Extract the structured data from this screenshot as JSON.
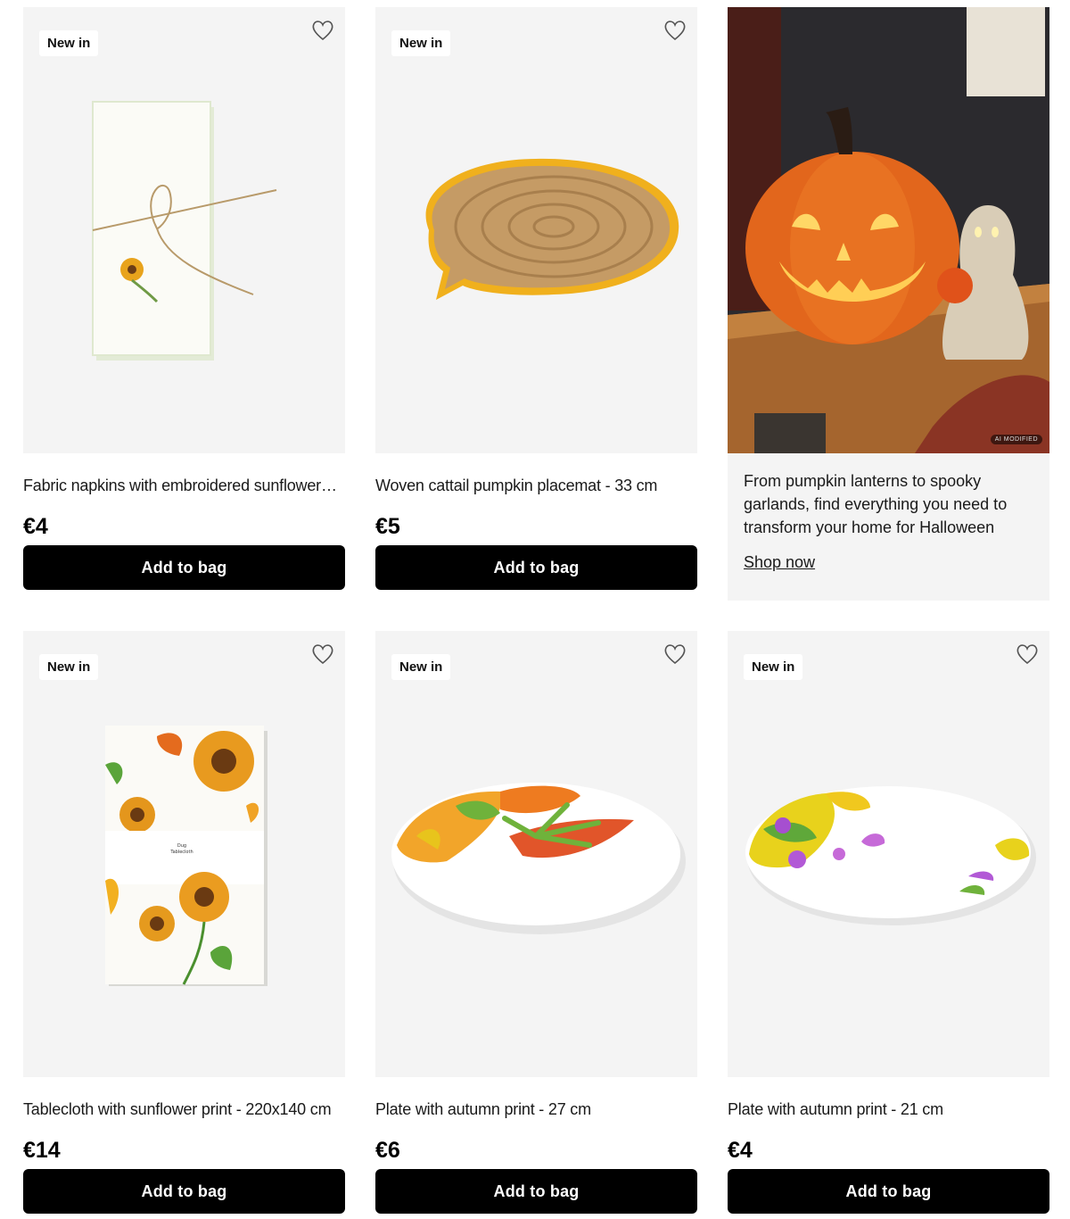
{
  "products": [
    {
      "badge": "New in",
      "title": "Fabric napkins with embroidered sunflower…",
      "price": "€4",
      "button": "Add to bag"
    },
    {
      "badge": "New in",
      "title": "Woven cattail pumpkin placemat - 33 cm",
      "price": "€5",
      "button": "Add to bag"
    },
    {
      "badge": "New in",
      "title": "Tablecloth with sunflower print - 220x140 cm",
      "price": "€14",
      "button": "Add to bag"
    },
    {
      "badge": "New in",
      "title": "Plate with autumn print - 27 cm",
      "price": "€6",
      "button": "Add to bag"
    },
    {
      "badge": "New in",
      "title": "Plate with autumn print - 21 cm",
      "price": "€4",
      "button": "Add to bag"
    }
  ],
  "promo": {
    "text": "From pumpkin lanterns to spooky garlands, find everything you need to transform your home for Halloween",
    "link": "Shop now",
    "ai_label": "AI MODIFIED"
  },
  "icons": {
    "wishlist": "heart-outline-icon"
  },
  "colors": {
    "button_bg": "#000000",
    "card_bg": "#f4f4f4"
  }
}
